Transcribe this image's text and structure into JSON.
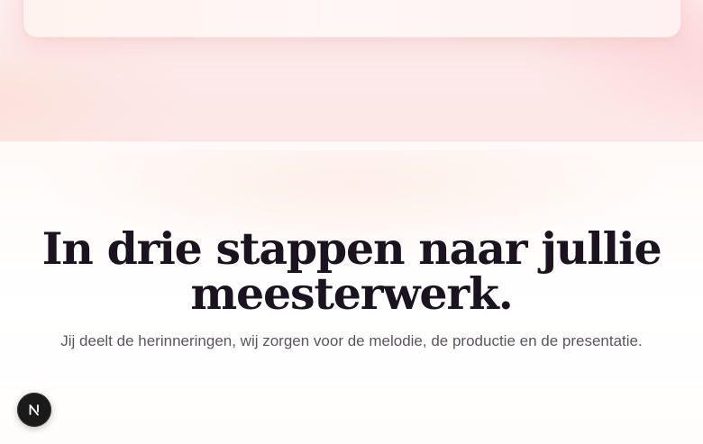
{
  "hero": {
    "card": {}
  },
  "steps": {
    "heading_line1": "In drie stappen naar jullie",
    "heading_line2": "meesterwerk.",
    "subtitle": "Jij deelt de herinneringen, wij zorgen voor de melodie, de productie en de presentatie."
  },
  "badge": {
    "icon": "n-logo-icon",
    "label": "N"
  }
}
